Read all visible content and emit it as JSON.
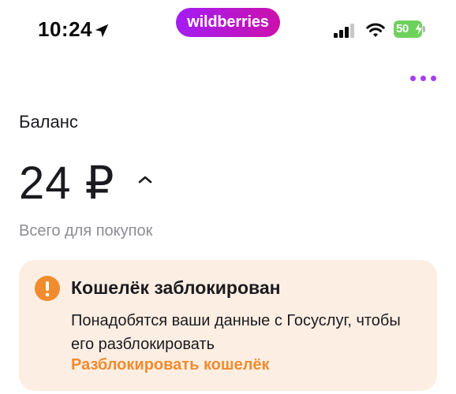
{
  "status_bar": {
    "time": "10:24",
    "brand": "wildberries",
    "battery": "50"
  },
  "icons": {
    "location": "location-arrow-icon",
    "signal": "cellular-signal-icon",
    "wifi": "wifi-icon",
    "charging": "bolt-icon",
    "more": "more-dots-icon",
    "expand": "chevron-up-icon",
    "alert": "exclamation-icon"
  },
  "colors": {
    "brand_gradient_start": "#a31df3",
    "brand_gradient_end": "#cb11ab",
    "accent_purple": "#a53df6",
    "alert_background": "#fdeee3",
    "alert_icon": "#f08c2e",
    "link_orange": "#f08c2e",
    "battery_green": "#6fd15d"
  },
  "balance": {
    "label": "Баланс",
    "amount": "24 ₽",
    "subtitle": "Всего для покупок"
  },
  "alert": {
    "title": "Кошелёк заблокирован",
    "text": "Понадобятся ваши данные с Госуслуг, чтобы его разблокировать",
    "link": "Разблокировать кошелёк"
  }
}
